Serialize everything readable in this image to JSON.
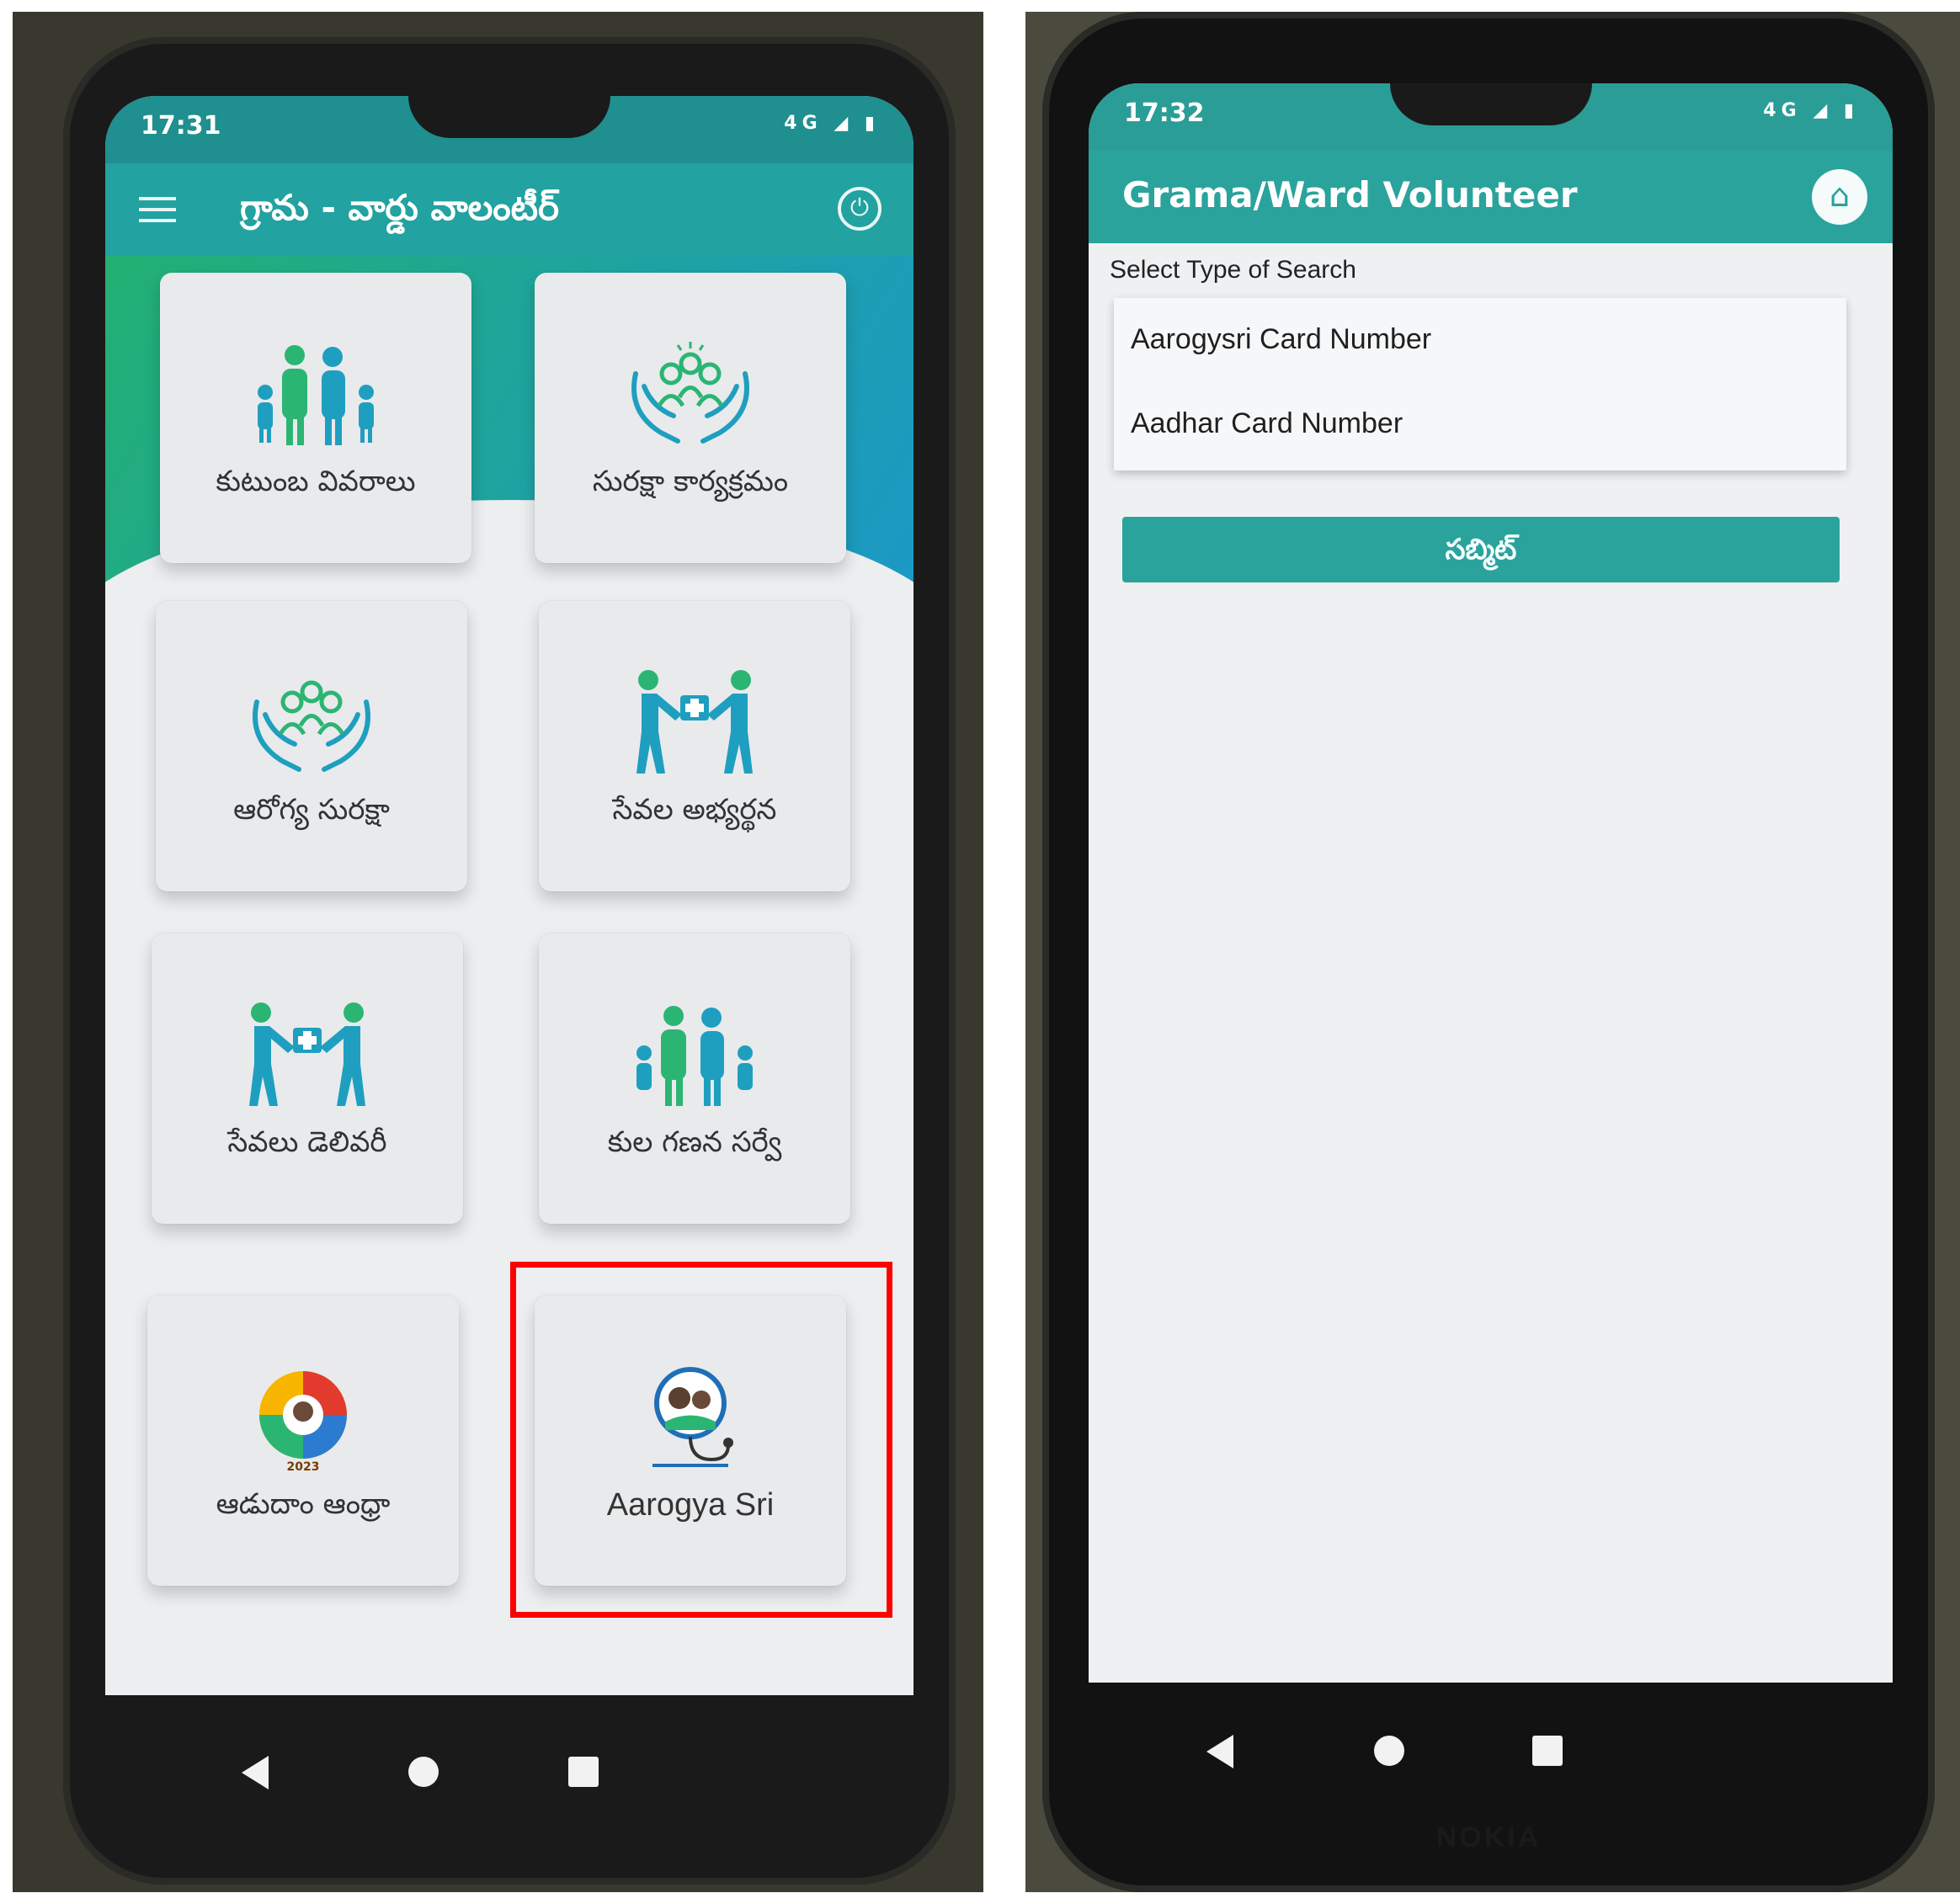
{
  "left_phone": {
    "status": {
      "time": "17:31",
      "network": "4G"
    },
    "title": "గ్రామ - వార్డు వాలంటీర్",
    "tiles": [
      {
        "label": "కుటుంబ వివరాలు",
        "icon": "family-icon"
      },
      {
        "label": "సురక్షా కార్యక్రమం",
        "icon": "care-hands-icon"
      },
      {
        "label": "ఆరోగ్య సురక్షా",
        "icon": "care-hands-icon"
      },
      {
        "label": "సేవల అభ్యర్థన",
        "icon": "service-exchange-icon"
      },
      {
        "label": "సేవలు డెలివరీ",
        "icon": "service-exchange-icon"
      },
      {
        "label": "కుల గణన సర్వే",
        "icon": "family-icon"
      },
      {
        "label": "ఆడుదాం ఆంధ్రా",
        "icon": "aadudam-andhra-logo",
        "logo_year": "2023"
      },
      {
        "label": "Aarogya Sri",
        "icon": "aarogya-sri-logo"
      }
    ],
    "highlight_color": "#ff0000"
  },
  "right_phone": {
    "status": {
      "time": "17:32",
      "network": "4G"
    },
    "title": "Grama/Ward Volunteer",
    "search_label": "Select Type of Search",
    "options": [
      "Aarogysri Card Number",
      "Aadhar Card Number"
    ],
    "submit_label": "సబ్మిట్",
    "brand": "NOKIA"
  },
  "colors": {
    "teal": "#2aa39c",
    "green": "#23b072",
    "blue": "#1c98c6"
  }
}
